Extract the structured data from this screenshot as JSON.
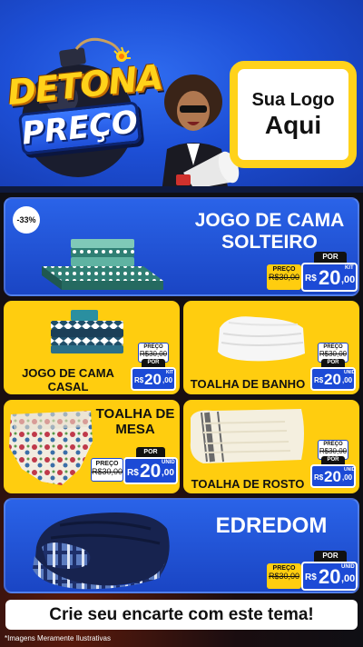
{
  "header": {
    "title_line1": "DETONA",
    "title_line2": "PREÇO",
    "logo_line1": "Sua Logo",
    "logo_line2": "Aqui"
  },
  "products": [
    {
      "name_line1": "JOGO DE CAMA",
      "name_line2": "SOLTEIRO",
      "discount": "-33%",
      "price_label_old": "PREÇO",
      "price_old": "R$30,00",
      "price_label_new": "POR",
      "currency": "R$",
      "price_int": "20",
      "price_dec": ",00",
      "unit": "KIT"
    },
    {
      "name_line1": "JOGO DE CAMA",
      "name_line2": "CASAL",
      "price_label_old": "PREÇO",
      "price_old": "R$30,00",
      "price_label_new": "POR",
      "currency": "R$",
      "price_int": "20",
      "price_dec": ",00",
      "unit": "KIT"
    },
    {
      "name_line1": "TOALHA DE BANHO",
      "price_label_old": "PREÇO",
      "price_old": "R$30,00",
      "price_label_new": "POR",
      "currency": "R$",
      "price_int": "20",
      "price_dec": ",00",
      "unit": "UNID"
    },
    {
      "name_line1": "TOALHA DE",
      "name_line2": "MESA",
      "price_label_old": "PREÇO",
      "price_old": "R$30,00",
      "price_label_new": "POR",
      "currency": "R$",
      "price_int": "20",
      "price_dec": ",00",
      "unit": "UNID"
    },
    {
      "name_line1": "TOALHA DE ROSTO",
      "price_label_old": "PREÇO",
      "price_old": "R$30,00",
      "price_label_new": "POR",
      "currency": "R$",
      "price_int": "20",
      "price_dec": ",00",
      "unit": "UNID"
    },
    {
      "name_line1": "EDREDOM",
      "price_label_old": "PREÇO",
      "price_old": "R$30,00",
      "price_label_new": "POR",
      "currency": "R$",
      "price_int": "20",
      "price_dec": ",00",
      "unit": "UNID"
    }
  ],
  "cta_text": "Crie seu encarte com este tema!",
  "disclaimer": "*Imagens Meramente Ilustrativas",
  "colors": {
    "brand_blue": "#1c4ad6",
    "brand_yellow": "#ffcd0f",
    "dark": "#0f0f14"
  },
  "icons": [
    "bomb-icon",
    "megaphone-icon",
    "bedsheet-icon",
    "towel-icon",
    "tablecloth-icon",
    "comforter-icon"
  ]
}
